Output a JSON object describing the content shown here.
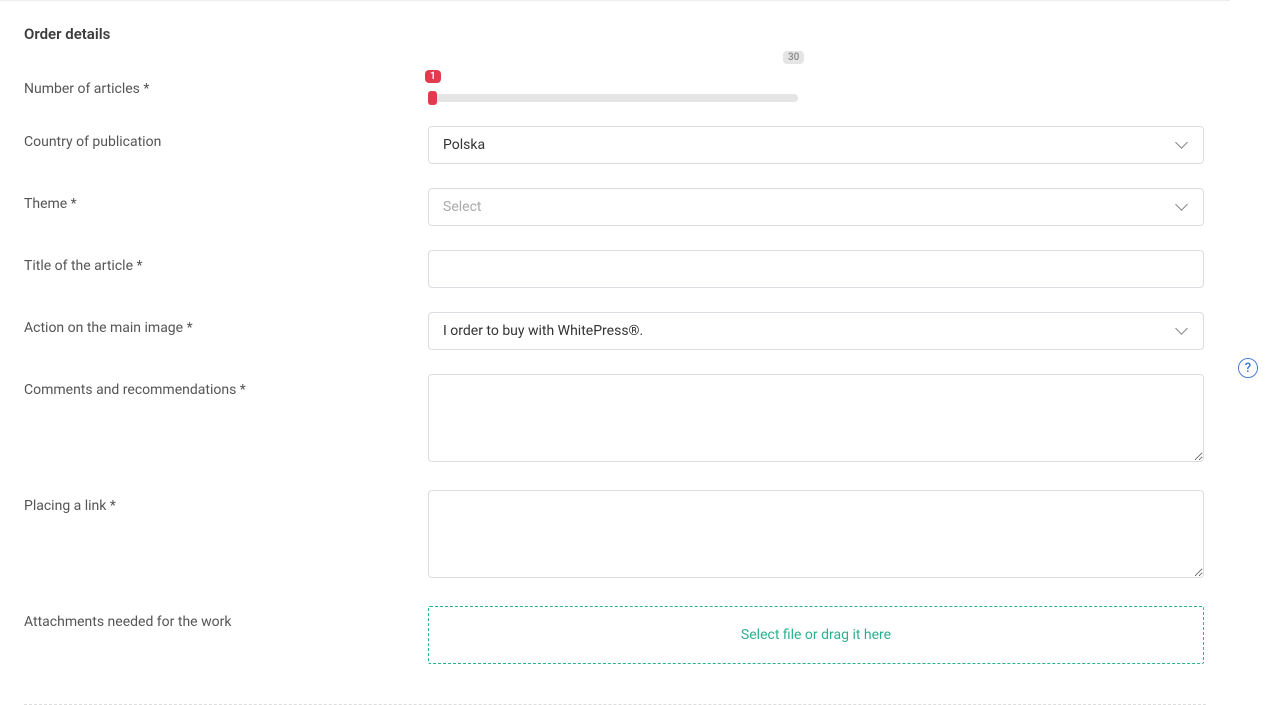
{
  "section": {
    "title": "Order details"
  },
  "labels": {
    "num_articles": "Number of articles *",
    "country": "Country of publication",
    "theme": "Theme *",
    "title": "Title of the article *",
    "action_image": "Action on the main image *",
    "comments": "Comments and recommendations *",
    "placing_link": "Placing a link *",
    "attachments": "Attachments needed for the work"
  },
  "fields": {
    "num_articles": {
      "value": "1",
      "max": "30"
    },
    "country": {
      "value": "Polska"
    },
    "theme": {
      "placeholder": "Select",
      "value": ""
    },
    "title": {
      "value": ""
    },
    "action_image": {
      "value": "I order to buy with WhitePress®."
    },
    "comments": {
      "value": ""
    },
    "placing_link": {
      "value": ""
    },
    "attachments": {
      "dropzone_text": "Select file or drag it here"
    }
  },
  "help": {
    "label": "?"
  }
}
